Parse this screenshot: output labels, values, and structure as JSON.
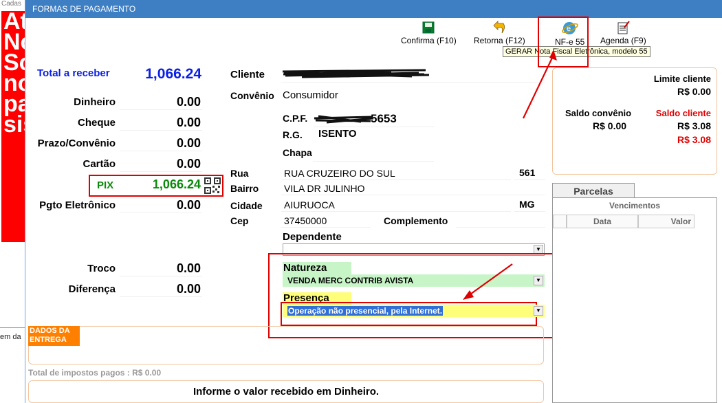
{
  "background": {
    "cadas": "Cadas",
    "red_text": [
      "At",
      "No",
      "So",
      "no",
      "pa",
      "sis"
    ],
    "em_da": "em da"
  },
  "window": {
    "title": "FORMAS DE PAGAMENTO"
  },
  "toolbar": {
    "confirma": "Confirma (F10)",
    "retorna": "Retorna (F12)",
    "nfe": "NF-e 55",
    "agenda": "Agenda (F9)",
    "tooltip": "GERAR  Nota Fiscal Eletrônica, modelo 55"
  },
  "totals": {
    "total_label": "Total a receber",
    "total_value": "1,066.24",
    "payments": [
      {
        "label": "Dinheiro",
        "value": "0.00"
      },
      {
        "label": "Cheque",
        "value": "0.00"
      },
      {
        "label": "Prazo/Convênio",
        "value": "0.00"
      },
      {
        "label": "Cartão",
        "value": "0.00"
      },
      {
        "label": "PIX",
        "value": "1,066.24"
      },
      {
        "label": "Pgto Eletrônico",
        "value": "0.00"
      }
    ],
    "troco_label": "Troco",
    "troco_value": "0.00",
    "diferenca_label": "Diferença",
    "diferenca_value": "0.00"
  },
  "client": {
    "cliente_label": "Cliente",
    "convenio_label": "Convênio",
    "convenio_value": "Consumidor",
    "cpf_label": "C.P.F.",
    "cpf_value": "5653",
    "rg_label": "R.G.",
    "rg_value": "ISENTO",
    "chapa_label": "Chapa",
    "rua_label": "Rua",
    "rua_value": "RUA CRUZEIRO DO SUL",
    "numero_value": "561",
    "bairro_label": "Bairro",
    "bairro_value": "VILA DR JULINHO",
    "cidade_label": "Cidade",
    "cidade_value": "AIURUOCA",
    "uf_value": "MG",
    "cep_label": "Cep",
    "cep_value": "37450000",
    "complemento_label": "Complemento",
    "dependente_label": "Dependente",
    "natureza_label": "Natureza",
    "natureza_value": "VENDA MERC CONTRIB  AVISTA",
    "presenca_label": "Presença",
    "presenca_value": "Operação não presencial, pela Internet."
  },
  "limits": {
    "limite_label": "Limite cliente",
    "limite_value": "R$ 0.00",
    "saldo_conv_label": "Saldo convênio",
    "saldo_conv_value": "R$ 0.00",
    "saldo_cli_label": "Saldo cliente",
    "saldo_cli_value1": "R$ 3.08",
    "saldo_cli_value2": "R$ 3.08"
  },
  "parcelas": {
    "tab": "Parcelas",
    "vencimentos": "Vencimentos",
    "col_data": "Data",
    "col_valor": "Valor"
  },
  "entrega": {
    "tag": "DADOS DA ENTREGA"
  },
  "footer": {
    "impostos": "Total de impostos pagos : R$ 0.00",
    "message": "Informe o valor recebido em Dinheiro."
  },
  "colors": {
    "title_bar": "#3e7fc4",
    "total_blue": "#0a1ee6",
    "pix_green": "#0a8a0a",
    "annotation_red": "#e00000",
    "natureza_bg": "#c8f5c8",
    "presenca_bg": "#fffe7a",
    "selection_blue": "#2f6fd6",
    "orange_tag": "#ff8000"
  }
}
